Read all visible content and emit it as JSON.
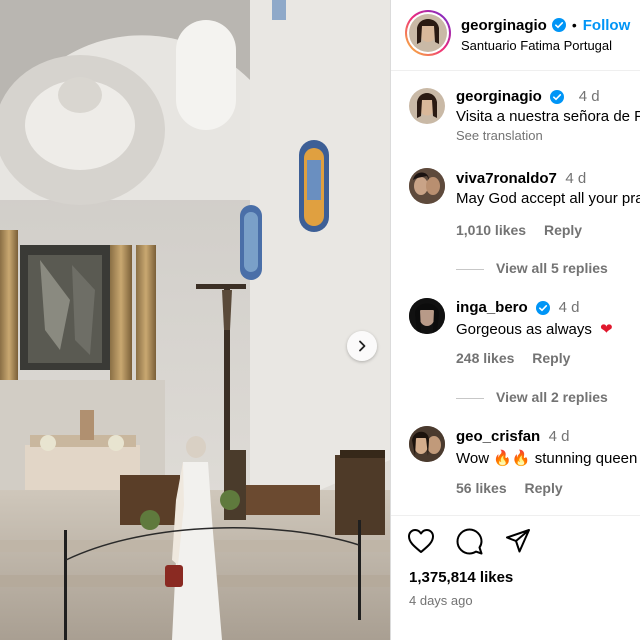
{
  "post": {
    "author": "georginagio",
    "dot": "•",
    "follow_label": "Follow",
    "location": "Santuario Fatima Portugal"
  },
  "caption": {
    "username": "georginagio",
    "time": "4 d",
    "text": "Visita a nuestra señora de Fátima",
    "see_translation": "See translation"
  },
  "comments": [
    {
      "username": "viva7ronaldo7",
      "verified": false,
      "time": "4 d",
      "text": "May God accept all your prayers",
      "likes": "1,010 likes",
      "reply": "Reply",
      "view_replies": "View all 5 replies"
    },
    {
      "username": "inga_bero",
      "verified": true,
      "time": "4 d",
      "text": "Gorgeous as always",
      "emoji": "❤",
      "likes": "248 likes",
      "reply": "Reply",
      "view_replies": "View all 2 replies"
    },
    {
      "username": "geo_crisfan",
      "verified": false,
      "time": "4 d",
      "text_before": "Wow",
      "emoji": "🔥🔥",
      "text_after": "stunning queen",
      "likes": "56 likes",
      "reply": "Reply"
    }
  ],
  "actions": {
    "like_icon": "heart-icon",
    "comment_icon": "comment-icon",
    "share_icon": "share-icon"
  },
  "stats": {
    "likes": "1,375,814 likes",
    "posted": "4 days ago"
  },
  "colors": {
    "accent": "#0095f6",
    "verified": "#0095f6",
    "heart_emoji": "#e0182d"
  }
}
